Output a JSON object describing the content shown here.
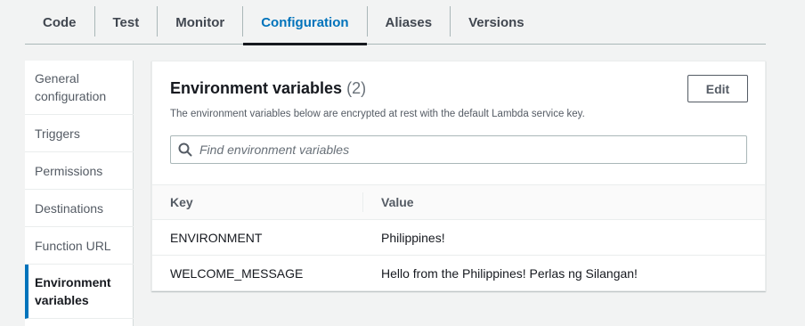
{
  "tabs": [
    {
      "label": "Code",
      "active": false
    },
    {
      "label": "Test",
      "active": false
    },
    {
      "label": "Monitor",
      "active": false
    },
    {
      "label": "Configuration",
      "active": true
    },
    {
      "label": "Aliases",
      "active": false
    },
    {
      "label": "Versions",
      "active": false
    }
  ],
  "sidenav": {
    "items": [
      {
        "label": "General configuration",
        "active": false
      },
      {
        "label": "Triggers",
        "active": false
      },
      {
        "label": "Permissions",
        "active": false
      },
      {
        "label": "Destinations",
        "active": false
      },
      {
        "label": "Function URL",
        "active": false
      },
      {
        "label": "Environment variables",
        "active": true
      }
    ]
  },
  "panel": {
    "title": "Environment variables",
    "count": "(2)",
    "description": "The environment variables below are encrypted at rest with the default Lambda service key.",
    "edit_label": "Edit",
    "search_placeholder": "Find environment variables",
    "search_icon": "search-icon",
    "columns": {
      "key": "Key",
      "value": "Value"
    },
    "rows": [
      {
        "key": "ENVIRONMENT",
        "value": "Philippines!"
      },
      {
        "key": "WELCOME_MESSAGE",
        "value": "Hello from the Philippines! Perlas ng Silangan!"
      }
    ]
  },
  "colors": {
    "accent": "#0073bb",
    "text": "#16191f",
    "background": "#f2f3f3"
  }
}
